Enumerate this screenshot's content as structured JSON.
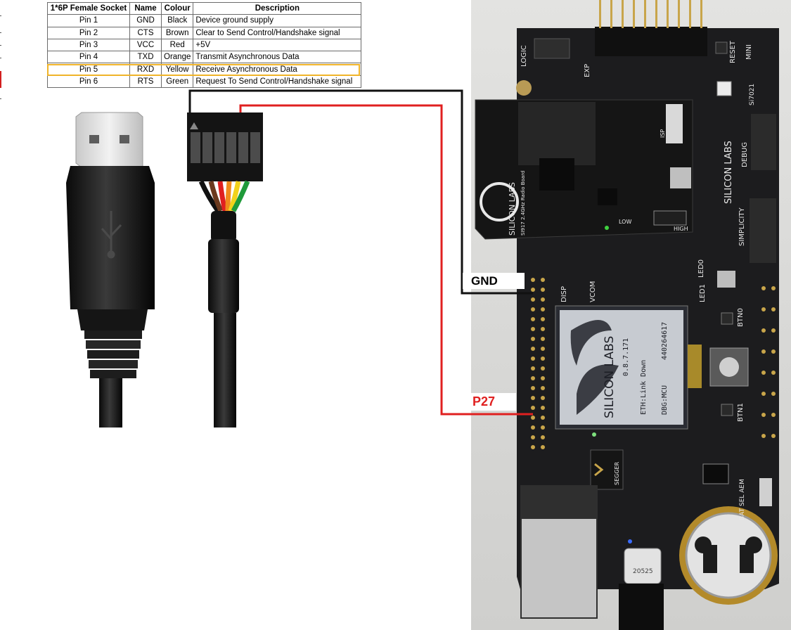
{
  "pin_table": {
    "headers": [
      "1*6P Female Socket",
      "Name",
      "Colour",
      "Description"
    ],
    "rows": [
      {
        "pin": "Pin 1",
        "name": "GND",
        "colour": "Black",
        "desc": "Device ground supply"
      },
      {
        "pin": "Pin 2",
        "name": "CTS",
        "colour": "Brown",
        "desc": "Clear to Send Control/Handshake signal"
      },
      {
        "pin": "Pin 3",
        "name": "VCC",
        "colour": "Red",
        "desc": "+5V"
      },
      {
        "pin": "Pin 4",
        "name": "TXD",
        "colour": "Orange",
        "desc": "Transmit Asynchronous Data"
      },
      {
        "pin": "Pin 5",
        "name": "RXD",
        "colour": "Yellow",
        "desc": "Receive Asynchronous Data"
      },
      {
        "pin": "Pin 6",
        "name": "RTS",
        "colour": "Green",
        "desc": "Request To Send Control/Handshake signal"
      }
    ],
    "highlighted_row": "Pin 5",
    "highlight_color": "#f0b429"
  },
  "connection_labels": {
    "gnd": "GND",
    "p27": "P27",
    "gnd_wire_color": "#111111",
    "p27_wire_color": "#e02020"
  },
  "board": {
    "brand": "SILICON LABS",
    "radio_board": "SI917 2.4GHz Radio Board",
    "logic": "LOGIC",
    "exp": "EXP",
    "reset": "RESET",
    "mini": "MINI",
    "si7021": "Si7021",
    "debug": "DEBUG",
    "simplicity": "SIMPLICITY",
    "disp": "DISP",
    "vcom": "VCOM",
    "led1": "LED1",
    "led0": "LED0",
    "btn0": "BTN0",
    "btn1": "BTN1",
    "segger": "SEGGER",
    "isp": "ISP",
    "low": "LOW",
    "high": "HIGH",
    "power_switch": "BAT SEL AEM",
    "usb_c_label": "20525"
  },
  "lcd": {
    "brand": "SILICON LABS",
    "version": "0.8.7.171",
    "eth": "ETH:Link Down",
    "dbg": "DBG:MCU",
    "id": "440264617"
  }
}
